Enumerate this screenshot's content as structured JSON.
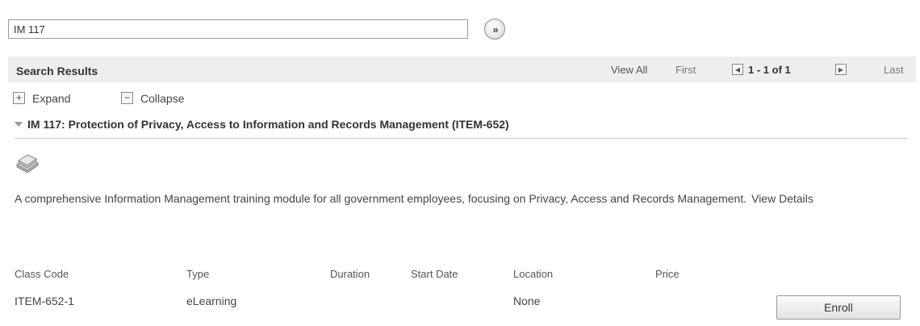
{
  "search": {
    "value": "IM 117",
    "go_label": "»"
  },
  "results": {
    "title": "Search Results",
    "view_all": "View All",
    "first": "First",
    "page_count": "1 - 1 of 1",
    "last": "Last"
  },
  "toggles": {
    "expand": "Expand",
    "collapse": "Collapse"
  },
  "item": {
    "title": "IM 117: Protection of Privacy, Access to Information and Records Management (ITEM-652)",
    "icon": "book-icon",
    "description": "A comprehensive Information Management training module for all government employees, focusing on Privacy, Access and Records Management.",
    "view_details": "View Details"
  },
  "table": {
    "headers": [
      "Class Code",
      "Type",
      "Duration",
      "Start Date",
      "Location",
      "Price"
    ],
    "rows": [
      {
        "class_code": "ITEM-652-1",
        "type": "eLearning",
        "duration": "",
        "start_date": "",
        "location": "None",
        "price": ""
      }
    ],
    "enroll_label": "Enroll"
  }
}
